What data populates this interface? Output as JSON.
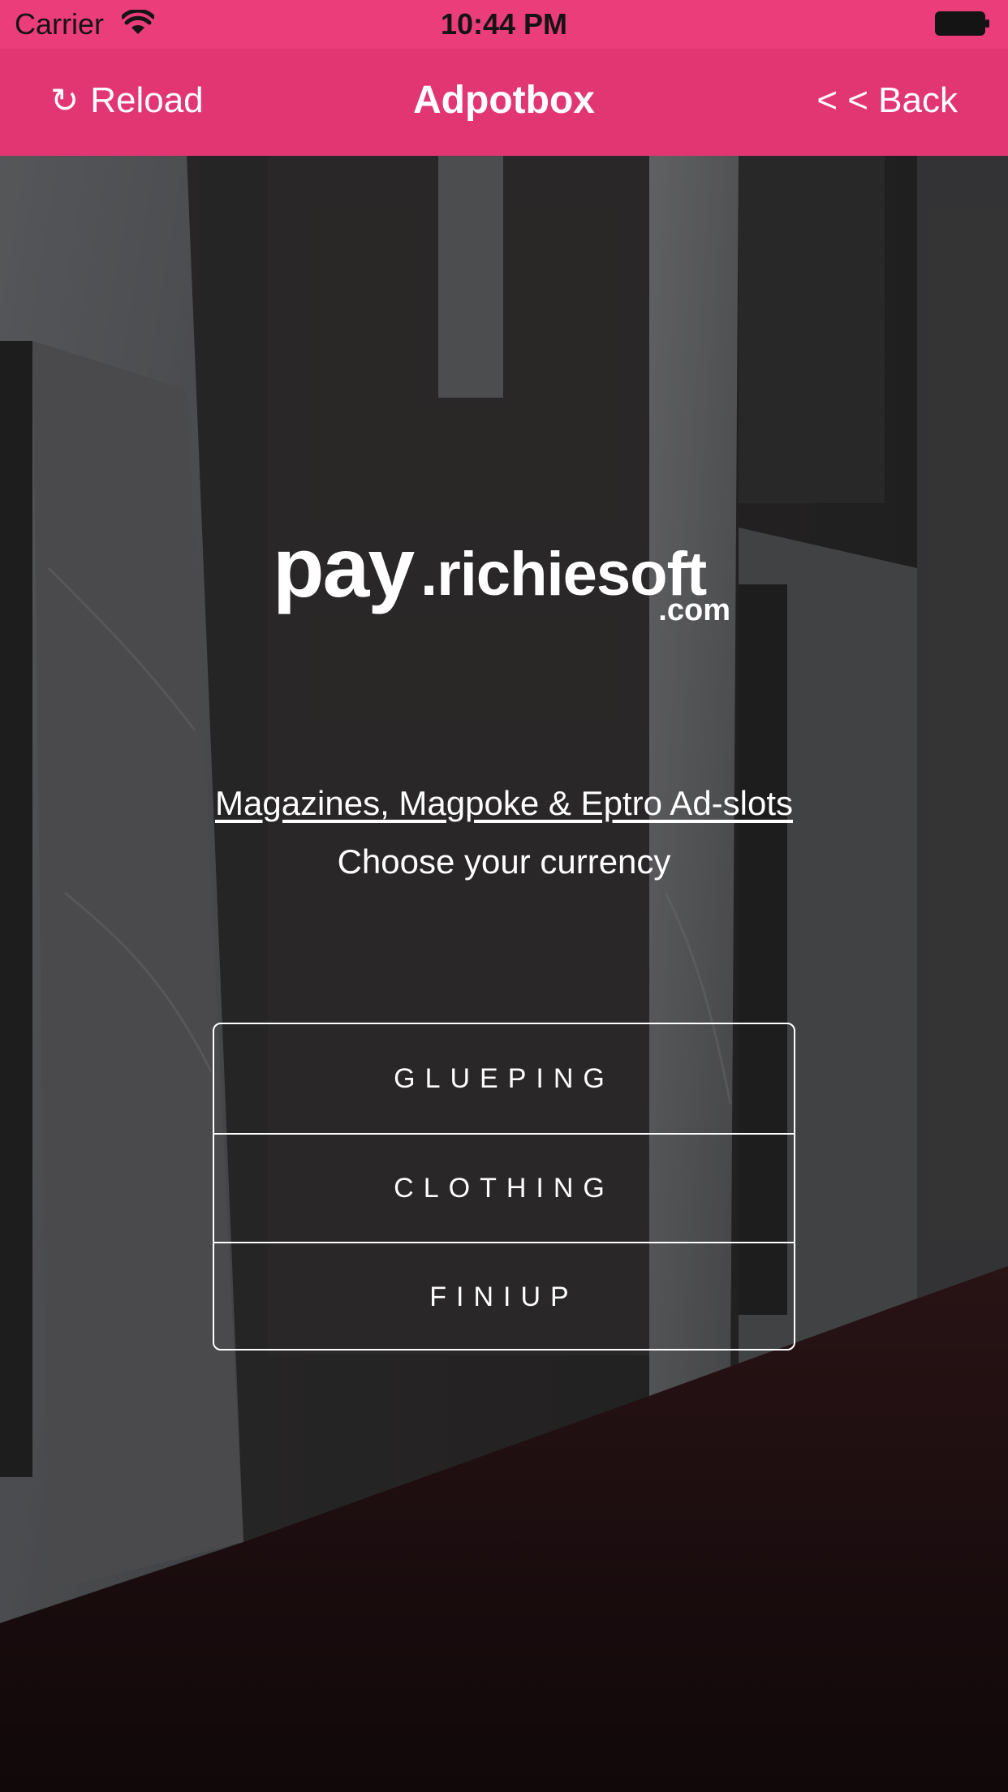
{
  "status_bar": {
    "carrier": "Carrier",
    "time": "10:44 PM",
    "wifi_icon": "wifi-icon",
    "battery_icon": "battery-icon"
  },
  "nav": {
    "reload_icon": "reload-icon",
    "reload_glyph": "↻",
    "reload_label": "Reload",
    "title": "Adpotbox",
    "back_label": "< < Back"
  },
  "logo": {
    "pay": "pay",
    "domain": ".richiesoft",
    "tld": ".com"
  },
  "content": {
    "link_text": "Magazines, Magpoke & Eptro Ad-slots",
    "prompt": "Choose your currency"
  },
  "options": [
    {
      "label": "GLUEPING"
    },
    {
      "label": "CLOTHING"
    },
    {
      "label": "FINIUP"
    }
  ],
  "colors": {
    "status_bar_bg": "#ec3d7b",
    "nav_bar_bg": "#e13672",
    "text": "#ffffff"
  }
}
